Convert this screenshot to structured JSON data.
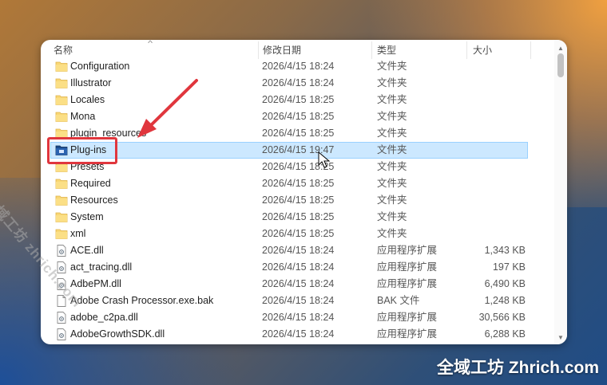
{
  "columns": {
    "name": "名称",
    "date": "修改日期",
    "type": "类型",
    "size": "大小"
  },
  "rows": [
    {
      "icon": "folder-icon",
      "name": "Configuration",
      "date": "2026/4/15 18:24",
      "type": "文件夹",
      "size": ""
    },
    {
      "icon": "folder-icon",
      "name": "Illustrator",
      "date": "2026/4/15 18:24",
      "type": "文件夹",
      "size": ""
    },
    {
      "icon": "folder-icon",
      "name": "Locales",
      "date": "2026/4/15 18:25",
      "type": "文件夹",
      "size": ""
    },
    {
      "icon": "folder-icon",
      "name": "Mona",
      "date": "2026/4/15 18:25",
      "type": "文件夹",
      "size": ""
    },
    {
      "icon": "folder-icon",
      "name": "plugin_resources",
      "date": "2026/4/15 18:25",
      "type": "文件夹",
      "size": ""
    },
    {
      "icon": "plugin-folder-icon",
      "name": "Plug-ins",
      "date": "2026/4/15 19:47",
      "type": "文件夹",
      "size": "",
      "selected": true
    },
    {
      "icon": "folder-icon",
      "name": "Presets",
      "date": "2026/4/15 18:25",
      "type": "文件夹",
      "size": ""
    },
    {
      "icon": "folder-icon",
      "name": "Required",
      "date": "2026/4/15 18:25",
      "type": "文件夹",
      "size": ""
    },
    {
      "icon": "folder-icon",
      "name": "Resources",
      "date": "2026/4/15 18:25",
      "type": "文件夹",
      "size": ""
    },
    {
      "icon": "folder-icon",
      "name": "System",
      "date": "2026/4/15 18:25",
      "type": "文件夹",
      "size": ""
    },
    {
      "icon": "folder-icon",
      "name": "xml",
      "date": "2026/4/15 18:25",
      "type": "文件夹",
      "size": ""
    },
    {
      "icon": "dll-file-icon",
      "name": "ACE.dll",
      "date": "2026/4/15 18:24",
      "type": "应用程序扩展",
      "size": "1,343 KB"
    },
    {
      "icon": "dll-file-icon",
      "name": "act_tracing.dll",
      "date": "2026/4/15 18:24",
      "type": "应用程序扩展",
      "size": "197 KB"
    },
    {
      "icon": "dll-file-icon",
      "name": "AdbePM.dll",
      "date": "2026/4/15 18:24",
      "type": "应用程序扩展",
      "size": "6,490 KB"
    },
    {
      "icon": "file-icon",
      "name": "Adobe Crash Processor.exe.bak",
      "date": "2026/4/15 18:24",
      "type": "BAK 文件",
      "size": "1,248 KB"
    },
    {
      "icon": "dll-file-icon",
      "name": "adobe_c2pa.dll",
      "date": "2026/4/15 18:24",
      "type": "应用程序扩展",
      "size": "30,566 KB"
    },
    {
      "icon": "dll-file-icon",
      "name": "AdobeGrowthSDK.dll",
      "date": "2026/4/15 18:24",
      "type": "应用程序扩展",
      "size": "6,288 KB"
    }
  ],
  "watermark": {
    "diagonal": "全域工坊 zhrich.com",
    "corner": "全域工坊 Zhrich.com"
  },
  "colors": {
    "folder": "#f8d775",
    "selection": "#cce8ff",
    "highlight": "#e0363d"
  }
}
